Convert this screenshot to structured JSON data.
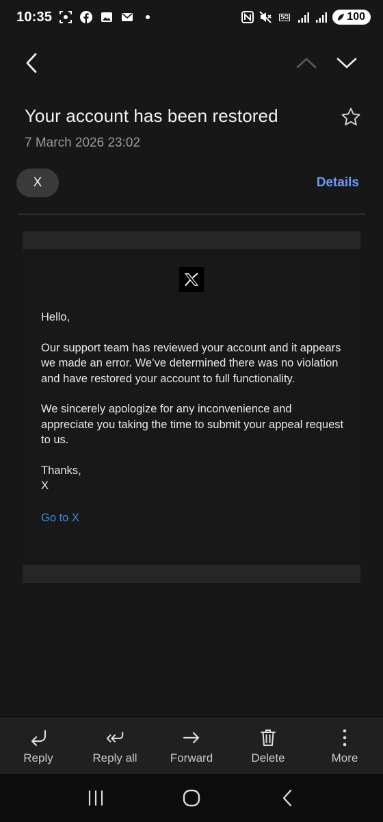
{
  "status_bar": {
    "time": "10:35",
    "network": "5G",
    "battery": "100",
    "icons": [
      "screenshot-icon",
      "facebook-icon",
      "gallery-icon",
      "gmail-icon",
      "dot-icon",
      "nfc-icon",
      "mute-icon",
      "signal-icon",
      "signal-icon",
      "battery-icon"
    ]
  },
  "nav": {
    "back_icon": "chevron-left-icon",
    "prev_icon": "chevron-up-icon",
    "next_icon": "chevron-down-icon"
  },
  "email": {
    "subject": "Your account has been restored",
    "date": "7 March 2026  23:02",
    "sender": "X",
    "details_label": "Details",
    "logo_text": "X",
    "greeting": "Hello,",
    "paragraph1": "Our support team has reviewed your account and it appears we made an error. We’ve determined there was no violation and have restored your account to full functionality.",
    "paragraph2": "We sincerely apologize for any inconvenience and appreciate you taking the time to submit your appeal request to us.",
    "signoff": "Thanks,",
    "signature": "X",
    "link_text": "Go to X"
  },
  "actions": {
    "reply": "Reply",
    "reply_all": "Reply all",
    "forward": "Forward",
    "delete": "Delete",
    "more": "More"
  },
  "colors": {
    "background": "#171717",
    "accent": "#6c9bf5",
    "link": "#3c8ce0",
    "card": "#252628"
  }
}
